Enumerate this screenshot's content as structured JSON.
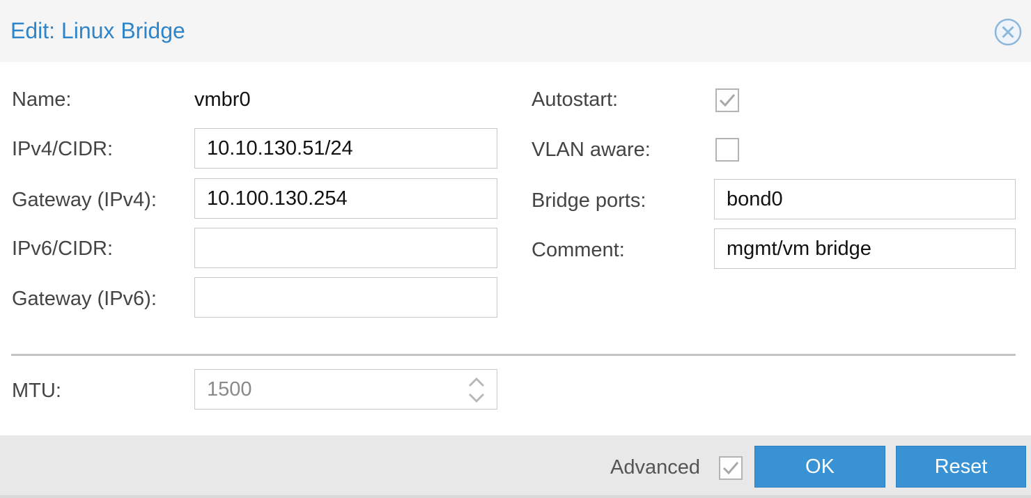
{
  "dialog": {
    "title": "Edit: Linux Bridge",
    "close_icon": "close-circle-icon"
  },
  "left": {
    "name_label": "Name:",
    "name_value": "vmbr0",
    "ipv4_label": "IPv4/CIDR:",
    "ipv4_value": "10.10.130.51/24",
    "gw4_label": "Gateway (IPv4):",
    "gw4_value": "10.100.130.254",
    "ipv6_label": "IPv6/CIDR:",
    "ipv6_value": "",
    "gw6_label": "Gateway (IPv6):",
    "gw6_value": ""
  },
  "right": {
    "autostart_label": "Autostart:",
    "autostart_checked": true,
    "vlan_label": "VLAN aware:",
    "vlan_checked": false,
    "ports_label": "Bridge ports:",
    "ports_value": "bond0",
    "comment_label": "Comment:",
    "comment_value": "mgmt/vm bridge"
  },
  "advanced": {
    "mtu_label": "MTU:",
    "mtu_value": "1500",
    "spinner_icon": "spinner-arrows-icon"
  },
  "footer": {
    "advanced_label": "Advanced",
    "advanced_checked": true,
    "ok_label": "OK",
    "reset_label": "Reset"
  },
  "colors": {
    "title": "#2f85c8",
    "button": "#3892d3",
    "header_bg": "#f5f5f5",
    "footer_bg": "#e8e8e8"
  }
}
